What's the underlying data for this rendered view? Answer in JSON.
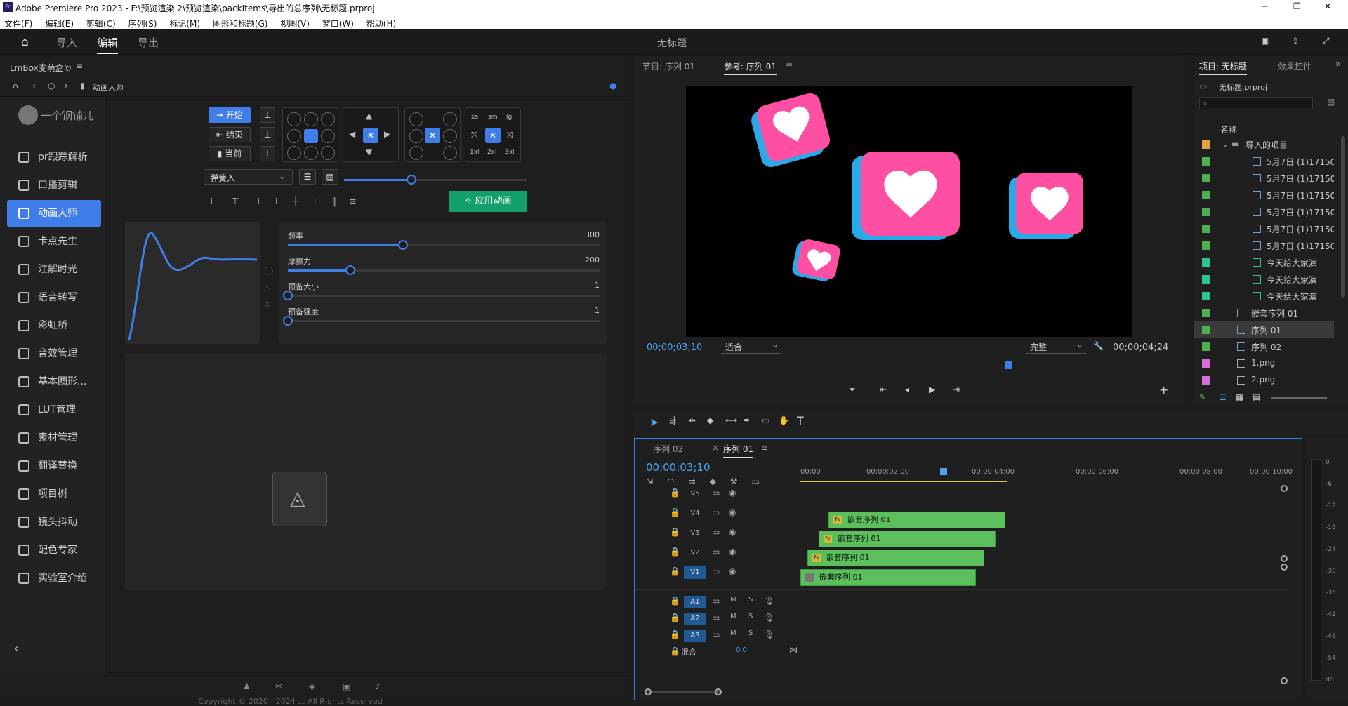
{
  "app": {
    "title": "Adobe Premiere Pro 2023 - F:\\预览渲染 2\\预览渲染\\packItems\\导出的总序列\\无标题.prproj"
  },
  "menu": [
    "文件(F)",
    "编辑(E)",
    "剪辑(C)",
    "序列(S)",
    "标记(M)",
    "图形和标题(G)",
    "视图(V)",
    "窗口(W)",
    "帮助(H)"
  ],
  "workspace": {
    "tabs": [
      "导入",
      "编辑",
      "导出"
    ],
    "active": "编辑",
    "project_title": "无标题"
  },
  "plugin": {
    "title": "LmBox麦萌盒©",
    "breadcrumb": "动画大师",
    "user": "一个钢铺儿",
    "sidebar": [
      "pr跟踪解析",
      "口播剪辑",
      "动画大师",
      "卡点先生",
      "注解时光",
      "语音转写",
      "彩虹桥",
      "音效管理",
      "基本图形...",
      "LUT管理",
      "素材管理",
      "翻译替换",
      "项目树",
      "镜头抖动",
      "配色专家",
      "实验室介绍"
    ],
    "active_item": "动画大师",
    "buttons": {
      "start": "开始",
      "end": "结束",
      "current": "当前"
    },
    "size_buttons": [
      "xs",
      "sm",
      "lg",
      "1xl",
      "2xl",
      "3xl"
    ],
    "easing_select": "弹簧入",
    "apply_button": "应用动画",
    "params": [
      {
        "label": "频率",
        "value": "300",
        "fraction": 0.37
      },
      {
        "label": "摩擦力",
        "value": "200",
        "fraction": 0.2
      },
      {
        "label": "预备大小",
        "value": "1",
        "fraction": 0.0
      },
      {
        "label": "预备强度",
        "value": "1",
        "fraction": 0.0
      }
    ],
    "main_slider_fraction": 0.37,
    "footer": "Copyright © 2020 - 2024 ... All Rights Reserved"
  },
  "program": {
    "tabs": [
      "节目: 序列 01",
      "参考: 序列 01"
    ],
    "active_tab": "参考: 序列 01",
    "timecode": "00;00;03;10",
    "fit": "适合",
    "quality": "完整",
    "duration": "00;00;04;24"
  },
  "project": {
    "tabs": [
      "项目: 无标题",
      "效果控件"
    ],
    "file": "无标题.prproj",
    "column": "名称",
    "items": [
      {
        "name": "导入的项目",
        "color": "#e6a23c",
        "type": "folder"
      },
      {
        "name": "5月7日 (1)17150",
        "color": "#4caf50",
        "type": "seq"
      },
      {
        "name": "5月7日 (1)17150",
        "color": "#4caf50",
        "type": "seq"
      },
      {
        "name": "5月7日 (1)17150",
        "color": "#4caf50",
        "type": "seq"
      },
      {
        "name": "5月7日 (1)17150",
        "color": "#4caf50",
        "type": "seq"
      },
      {
        "name": "5月7日 (1)17150",
        "color": "#4caf50",
        "type": "seq"
      },
      {
        "name": "5月7日 (1)17150",
        "color": "#4caf50",
        "type": "seq"
      },
      {
        "name": "今天给大家演",
        "color": "#2bc48a",
        "type": "audio"
      },
      {
        "name": "今天给大家演",
        "color": "#2bc48a",
        "type": "audio"
      },
      {
        "name": "今天给大家演",
        "color": "#2bc48a",
        "type": "audio"
      },
      {
        "name": "嵌套序列 01",
        "color": "#4caf50",
        "type": "seq"
      },
      {
        "name": "序列 01",
        "color": "#4caf50",
        "type": "seq"
      },
      {
        "name": "序列 02",
        "color": "#4caf50",
        "type": "seq"
      },
      {
        "name": "1.png",
        "color": "#d96fd9",
        "type": "img"
      },
      {
        "name": "2.png",
        "color": "#d96fd9",
        "type": "img"
      }
    ]
  },
  "timeline": {
    "tabs": [
      "序列 02",
      "序列 01"
    ],
    "active_tab": "序列 01",
    "timecode": "00;00;03;10",
    "ruler": [
      "00;00",
      "00;00;02;00",
      "00;00;04;00",
      "00;00;06;00",
      "00;00;08;00",
      "00;00;10;00"
    ],
    "video_tracks": [
      "V5",
      "V4",
      "V3",
      "V2",
      "V1"
    ],
    "audio_tracks": [
      "A1",
      "A2",
      "A3"
    ],
    "mix_label": "混合",
    "mix_value": "0.0",
    "clip_name": "嵌套序列 01",
    "meter_scale": [
      "0",
      "-6",
      "-12",
      "-18",
      "-24",
      "-30",
      "-36",
      "-42",
      "-48",
      "-54",
      "dB"
    ]
  }
}
